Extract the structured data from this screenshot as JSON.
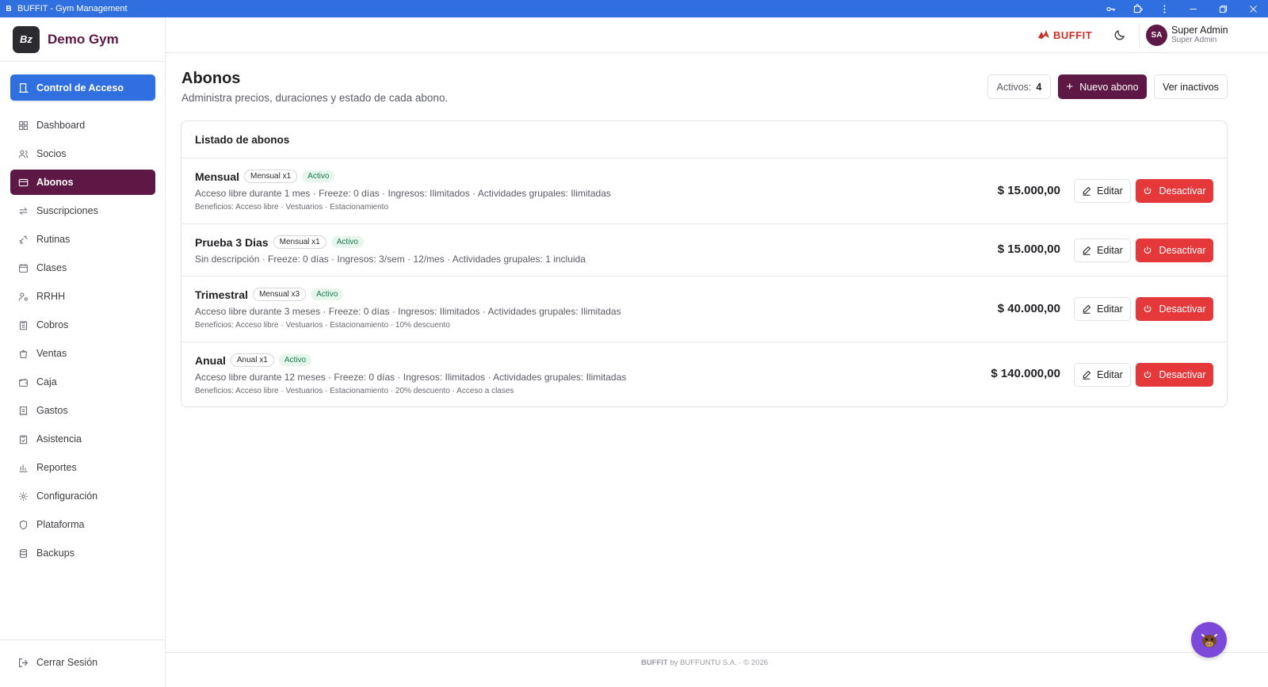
{
  "titlebar": {
    "app_letter": "B",
    "title": "BUFFIT - Gym Management",
    "icons": [
      "key-icon",
      "extension-icon",
      "more-vert-icon"
    ],
    "window_controls": [
      "minimize",
      "restore",
      "close"
    ]
  },
  "sidebar": {
    "brand_logo": "Bz",
    "brand_name": "Demo Gym",
    "access_button": "Control de Acceso",
    "items": [
      {
        "label": "Dashboard",
        "icon": "grid-icon",
        "active": false
      },
      {
        "label": "Socios",
        "icon": "users-icon",
        "active": false
      },
      {
        "label": "Abonos",
        "icon": "card-icon",
        "active": true
      },
      {
        "label": "Suscripciones",
        "icon": "repeat-icon",
        "active": false
      },
      {
        "label": "Rutinas",
        "icon": "dumbbell-icon",
        "active": false
      },
      {
        "label": "Clases",
        "icon": "calendar-icon",
        "active": false
      },
      {
        "label": "RRHH",
        "icon": "user-cog-icon",
        "active": false
      },
      {
        "label": "Cobros",
        "icon": "clipboard-icon",
        "active": false
      },
      {
        "label": "Ventas",
        "icon": "shopping-bag-icon",
        "active": false
      },
      {
        "label": "Caja",
        "icon": "wallet-icon",
        "active": false
      },
      {
        "label": "Gastos",
        "icon": "receipt-icon",
        "active": false
      },
      {
        "label": "Asistencia",
        "icon": "clipboard-check-icon",
        "active": false
      },
      {
        "label": "Reportes",
        "icon": "bar-chart-icon",
        "active": false
      },
      {
        "label": "Configuración",
        "icon": "gear-icon",
        "active": false
      },
      {
        "label": "Plataforma",
        "icon": "shield-icon",
        "active": false
      },
      {
        "label": "Backups",
        "icon": "database-icon",
        "active": false
      }
    ],
    "logout": "Cerrar Sesión"
  },
  "header": {
    "logo_text": "BUFFIT",
    "avatar_initials": "SA",
    "user_name": "Super Admin",
    "user_role": "Super Admin"
  },
  "page": {
    "title": "Abonos",
    "subtitle": "Administra precios, duraciones y estado de cada abono.",
    "active_label": "Activos:",
    "active_count": "4",
    "new_button": "Nuevo abono",
    "inactive_button": "Ver inactivos"
  },
  "list": {
    "title": "Listado de abonos",
    "edit_label": "Editar",
    "deactivate_label": "Desactivar",
    "rows": [
      {
        "name": "Mensual",
        "chip": "Mensual x1",
        "status": "Activo",
        "description": "Acceso libre durante 1 mes · Freeze: 0 días · Ingresos: Ilimitados · Actividades grupales: Ilimitadas",
        "benefits": "Beneficios: Acceso libre · Vestuarios · Estacionamiento",
        "price": "$ 15.000,00"
      },
      {
        "name": "Prueba 3 Dias",
        "chip": "Mensual x1",
        "status": "Activo",
        "description": "Sin descripción · Freeze: 0 días · Ingresos: 3/sem · 12/mes · Actividades grupales: 1 incluida",
        "benefits": "",
        "price": "$ 15.000,00"
      },
      {
        "name": "Trimestral",
        "chip": "Mensual x3",
        "status": "Activo",
        "description": "Acceso libre durante 3 meses · Freeze: 0 días · Ingresos: Ilimitados · Actividades grupales: Ilimitadas",
        "benefits": "Beneficios: Acceso libre · Vestuarios · Estacionamiento · 10% descuento",
        "price": "$ 40.000,00"
      },
      {
        "name": "Anual",
        "chip": "Anual x1",
        "status": "Activo",
        "description": "Acceso libre durante 12 meses · Freeze: 0 días · Ingresos: Ilimitados · Actividades grupales: Ilimitadas",
        "benefits": "Beneficios: Acceso libre · Vestuarios · Estacionamiento · 20% descuento · Acceso a clases",
        "price": "$ 140.000,00"
      }
    ]
  },
  "footer": {
    "brand": "BUFFIT",
    "text": " by BUFFUNTU S.A. · © 2026"
  },
  "colors": {
    "primary": "#5e1846",
    "accent_blue": "#2f6fe0",
    "danger": "#e5383b",
    "success": "#18794e"
  }
}
